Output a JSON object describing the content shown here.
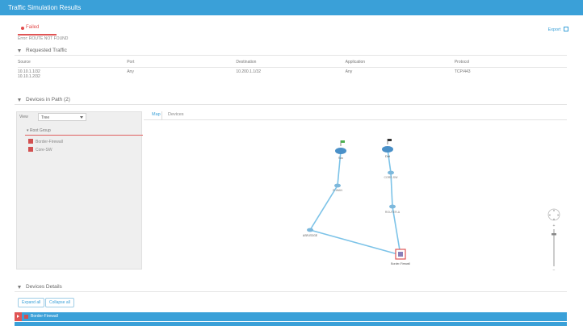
{
  "header": {
    "title": "Traffic Simulation Results"
  },
  "status": {
    "label": "Failed",
    "sub": "Error: ROUTE NOT FOUND",
    "color": "#e24b4b"
  },
  "export": {
    "label": "Export"
  },
  "requested_traffic": {
    "label": "Requested Traffic",
    "columns": [
      "Source",
      "Port",
      "Destination",
      "Application",
      "Protocol"
    ],
    "rows": [
      [
        "10.10.1.1/32\n10.10.1.2/32",
        "Any",
        "10.200.1.1/32",
        "Any",
        "TCP/443"
      ]
    ]
  },
  "devices_in_path": {
    "label": "Devices in Path (2)",
    "view_label": "View",
    "view_value": "Tree",
    "tree_root": "Root Group",
    "tree_items": [
      "Border-Firewall",
      "Core-SW"
    ]
  },
  "tabs": [
    {
      "label": "Map",
      "active": true
    },
    {
      "label": "Devices",
      "active": false
    }
  ],
  "map": {
    "nodes": [
      {
        "id": "a",
        "label": "Src",
        "type": "cloud",
        "flag_color": "#4caf50"
      },
      {
        "id": "b",
        "label": "Dst",
        "type": "cloud",
        "flag_color": "#333333"
      },
      {
        "id": "c",
        "label": "R-WAN",
        "type": "router"
      },
      {
        "id": "d",
        "label": "ASR-EDGE",
        "type": "router"
      },
      {
        "id": "e",
        "label": "CORE-SW",
        "type": "router"
      },
      {
        "id": "f",
        "label": "ROUTER-A",
        "type": "router"
      },
      {
        "id": "g",
        "label": "Border-Firewall",
        "type": "firewall"
      }
    ]
  },
  "device_details": {
    "label": "Devices Details",
    "expand_all": "Expand all",
    "collapse_all": "Collapse all",
    "rows": [
      {
        "label": "Border-Firewall"
      }
    ]
  },
  "colors": {
    "accent": "#3aa0d8",
    "danger": "#e05555"
  }
}
